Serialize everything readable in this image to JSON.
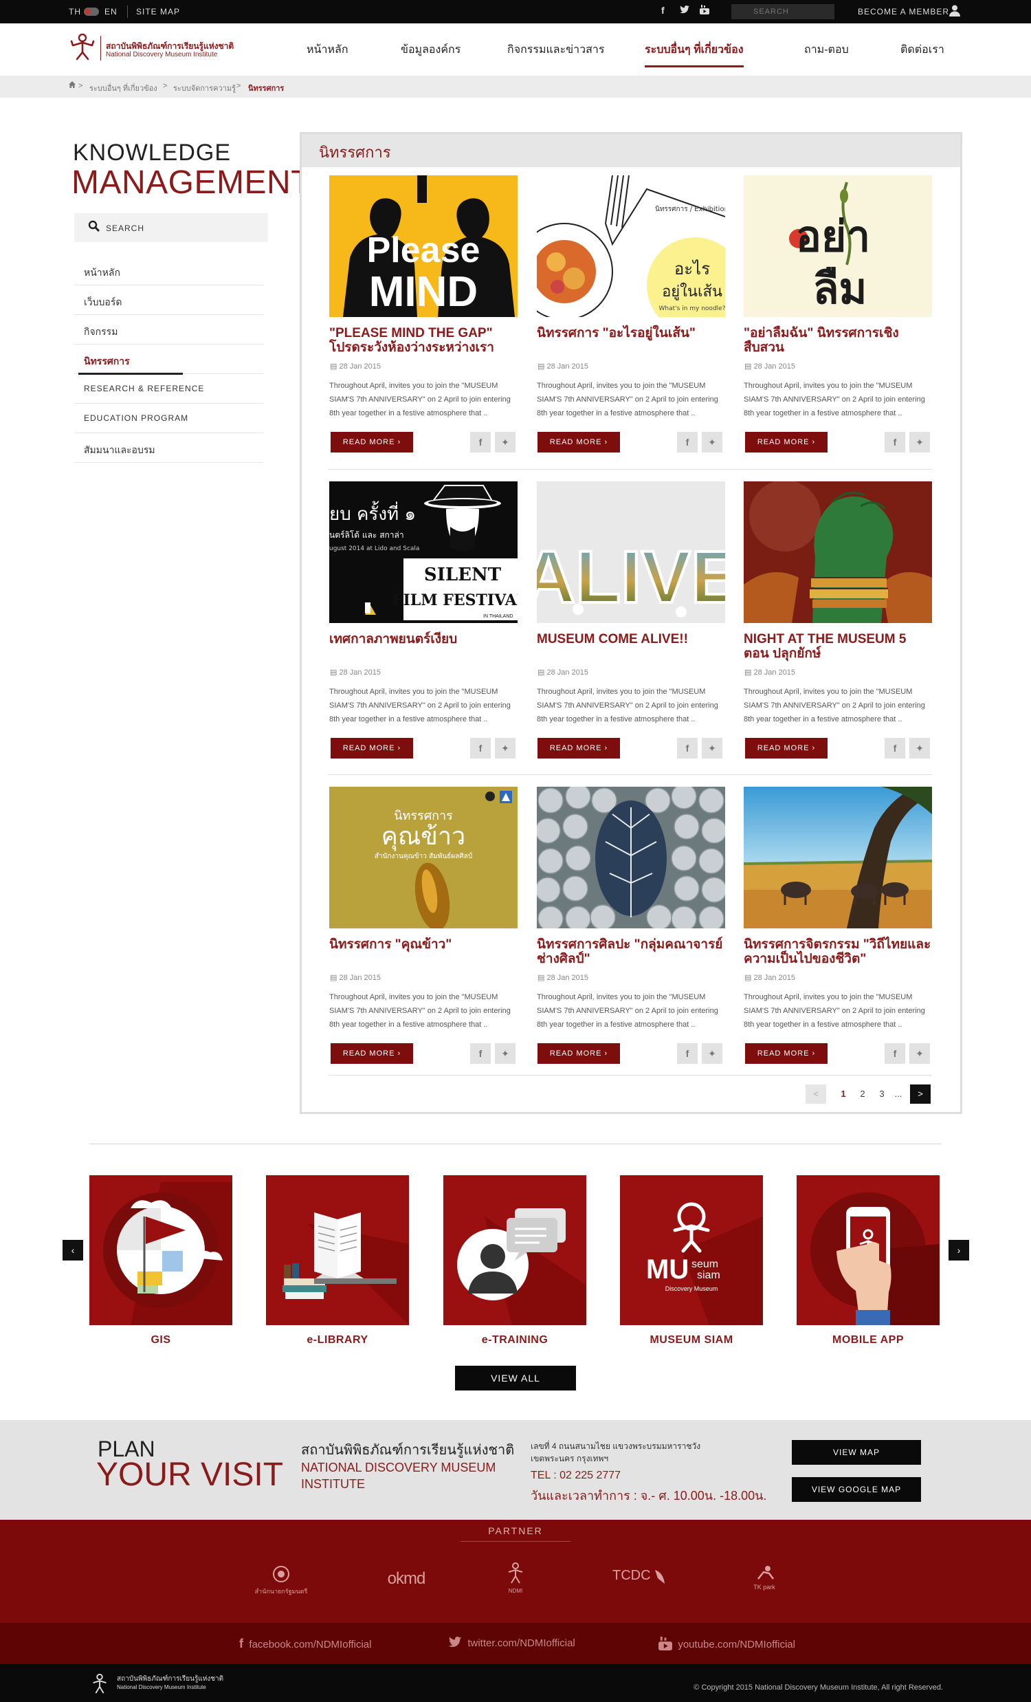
{
  "topbar": {
    "lang_th": "TH",
    "lang_en": "EN",
    "sitemap": "SITE MAP",
    "search_placeholder": "SEARCH",
    "member": "BECOME A MEMBER"
  },
  "header": {
    "logo_th": "สถาบันพิพิธภัณฑ์การเรียนรู้แห่งชาติ",
    "logo_en": "National Discovery Museum Institute",
    "nav": [
      "หน้าหลัก",
      "ข้อมูลองค์กร",
      "กิจกรรมและข่าวสาร",
      "ระบบอื่นๆ ที่เกี่ยวข้อง",
      "ถาม-ตอบ",
      "ติดต่อเรา"
    ],
    "active_nav": "ระบบอื่นๆ ที่เกี่ยวข้อง"
  },
  "breadcrumb": {
    "sep": ">",
    "items": [
      "ระบบอื่นๆ ที่เกี่ยวข้อง",
      "ระบบจัดการความรู้",
      "นิทรรศการ"
    ]
  },
  "sidebar": {
    "title_line1": "KNOWLEDGE",
    "title_line2": "MANAGEMENT",
    "search_placeholder": "SEARCH",
    "items": [
      "หน้าหลัก",
      "เว็บบอร์ด",
      "กิจกรรม",
      "นิทรรศการ",
      "RESEARCH & REFERENCE",
      "EDUCATION PROGRAM",
      "สัมมนาและอบรม"
    ],
    "active_item": "นิทรรศการ"
  },
  "content": {
    "title": "นิทรรศการ",
    "read_more": "READ MORE",
    "date": "28 Jan 2015",
    "excerpt": "Throughout April, invites you to join the \"MUSEUM SIAM'S 7th ANNIVERSARY\" on 2 April to join entering 8th year together in a festive atmosphere that ..",
    "cards": [
      {
        "title": "\"PLEASE MIND THE GAP\" โปรดระวังห้องว่างระหว่างเรา",
        "img_text": [
          "Please",
          "MIND"
        ]
      },
      {
        "title": "นิทรรศการ \"อะไรอยู่ในเส้น\"",
        "img_text": [
          "นิทรรศการ / Exhibition",
          "อะไร",
          "อยู่ในเส้น",
          "What's in my noodle?"
        ]
      },
      {
        "title": "\"อย่าลืมฉัน\" นิทรรศการเชิงสืบสวน",
        "img_text": [
          "อย่า",
          "ลืม"
        ]
      },
      {
        "title": "เทศกาลภาพยนตร์เงียบ",
        "img_text": [
          "ยบ ครั้งที่ ๑",
          "นตร์ลิโด้ และ สกาล่า",
          "ugust 2014 at Lido and Scala",
          "SILENT",
          "FILM FESTIVAL",
          "IN THAILAND"
        ]
      },
      {
        "title": "MUSEUM COME ALIVE!!",
        "img_text": [
          "ALIVE"
        ]
      },
      {
        "title": "NIGHT AT THE MUSEUM 5 ตอน ปลุกยักษ์",
        "img_text": []
      },
      {
        "title": "นิทรรศการ \"คุณข้าว\"",
        "img_text": [
          "นิทรรศการ",
          "คุณข้าว",
          "สำนักงานคุณข้าว สัมพันธ์ผลศิลป์"
        ]
      },
      {
        "title": "นิทรรศการศิลปะ \"กลุ่มคณาจารย์ช่างศิลป์\"",
        "img_text": []
      },
      {
        "title": "นิทรรศการจิตรกรรม \"วิถีไทยและความเป็นไปของชีวิต\"",
        "img_text": []
      }
    ],
    "pagination": {
      "prev": "<",
      "pages": [
        "1",
        "2",
        "3",
        "..."
      ],
      "current": "1",
      "next": ">"
    }
  },
  "services": {
    "items": [
      "GIS",
      "e-LIBRARY",
      "e-TRAINING",
      "MUSEUM SIAM",
      "MOBILE APP"
    ],
    "museum_logo_text": [
      "MU",
      "seum",
      "siam",
      "Discovery Museum"
    ],
    "view_all": "VIEW ALL"
  },
  "plan": {
    "line1": "PLAN",
    "line2": "YOUR VISIT",
    "inst_th": "สถาบันพิพิธภัณฑ์การเรียนรู้แห่งชาติ",
    "inst_en": "NATIONAL DISCOVERY MUSEUM INSTITUTE",
    "address": "เลขที่ 4 ถนนสนามไชย แขวงพระบรมมหาราชวัง เขตพระนคร กรุงเทพฯ",
    "tel": "TEL : 02 225 2777",
    "hours": "วันและเวลาทำการ : จ.- ศ. 10.00น. -18.00น.",
    "view_map": "VIEW MAP",
    "view_google_map": "VIEW GOOGLE MAP"
  },
  "partner": {
    "title": "PARTNER",
    "logos": [
      "สำนักนายกรัฐมนตรี",
      "okmd",
      "NDMI",
      "TCDC",
      "TK park"
    ]
  },
  "social": {
    "facebook": "facebook.com/NDMIofficial",
    "twitter": "twitter.com/NDMIofficial",
    "youtube": "youtube.com/NDMIofficial"
  },
  "footer": {
    "logo_th": "สถาบันพิพิธภัณฑ์การเรียนรู้แห่งชาติ",
    "logo_en": "National Discovery Museum Institute",
    "copyright": "© Copyright 2015 National Discovery Museum Institute, All right Reserved."
  },
  "colors": {
    "brand": "#8b1a1a",
    "button": "#7e0e0e",
    "partner_bg": "#7d0a0a",
    "social_bg": "#5e0404"
  }
}
